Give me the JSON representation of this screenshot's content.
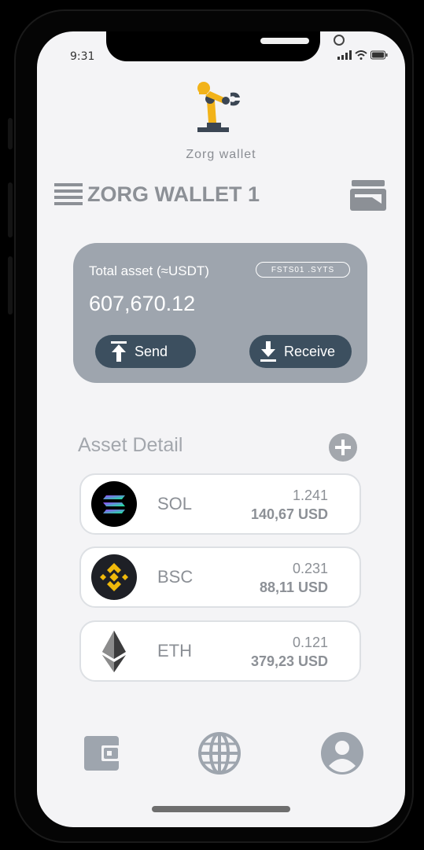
{
  "status_bar": {
    "time": "9:31",
    "icons": [
      "signal-icon",
      "wifi-icon",
      "battery-icon"
    ]
  },
  "brand": {
    "logo": "robot-arm-logo",
    "name": "Zorg wallet"
  },
  "header": {
    "menu_icon": "hamburger-icon",
    "wallet_name": "ZORG WALLET 1",
    "switch_icon": "wallet-switch-icon"
  },
  "asset_card": {
    "total_label": "Total asset (≈USDT)",
    "pill_label": "FSTS01 .SYTS",
    "total_value": "607,670.12",
    "send_label": "Send",
    "receive_label": "Receive"
  },
  "asset_detail": {
    "title": "Asset Detail",
    "add_icon": "plus-circle-icon",
    "assets": [
      {
        "symbol": "SOL",
        "amount": "1.241",
        "usd": "140,67 USD",
        "icon": "solana-icon"
      },
      {
        "symbol": "BSC",
        "amount": "0.231",
        "usd": "88,11 USD",
        "icon": "binance-icon"
      },
      {
        "symbol": "ETH",
        "amount": "0.121",
        "usd": "379,23 USD",
        "icon": "ethereum-icon"
      }
    ]
  },
  "bottom_nav": {
    "items": [
      "wallet-icon",
      "globe-icon",
      "profile-icon"
    ]
  },
  "colors": {
    "card_bg": "#9ea5ae",
    "button_bg": "#3c4f5f",
    "text_gray": "#8c9096",
    "screen_bg": "#f4f4f6"
  }
}
